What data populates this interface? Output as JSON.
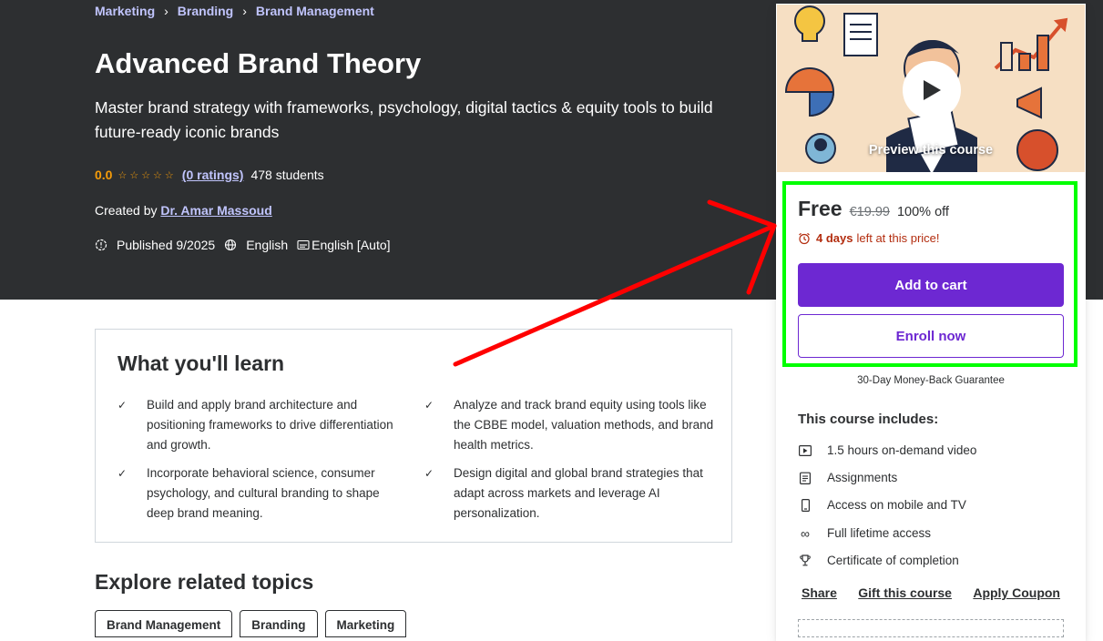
{
  "breadcrumb": [
    "Marketing",
    "Branding",
    "Brand Management"
  ],
  "course": {
    "title": "Advanced Brand Theory",
    "subtitle": "Master brand strategy with frameworks, psychology, digital tactics & equity tools to build future-ready iconic brands",
    "rating": "0.0",
    "stars": "☆☆☆☆☆",
    "ratings_count": "(0 ratings)",
    "students": "478 students",
    "created_by_label": "Created by",
    "instructor": "Dr. Amar Massoud",
    "published": "Published 9/2025",
    "language": "English",
    "captions": "English [Auto]"
  },
  "learn": {
    "title": "What you'll learn",
    "check_icon": "✓",
    "items": [
      "Build and apply brand architecture and positioning frameworks to drive differentiation and growth.",
      "Analyze and track brand equity using tools like the CBBE model, valuation methods, and brand health metrics.",
      "Incorporate behavioral science, consumer psychology, and cultural branding to shape deep brand meaning.",
      "Design digital and global brand strategies that adapt across markets and leverage AI personalization."
    ]
  },
  "explore": {
    "title": "Explore related topics",
    "topics": [
      "Brand Management",
      "Branding",
      "Marketing"
    ]
  },
  "sidebar": {
    "preview_label": "Preview this course",
    "price": "Free",
    "original_price": "€19.99",
    "discount": "100% off",
    "timer_days": "4 days",
    "timer_text": "left at this price!",
    "add_to_cart": "Add to cart",
    "enroll_now": "Enroll now",
    "guarantee": "30-Day Money-Back Guarantee",
    "includes_title": "This course includes:",
    "includes": [
      {
        "icon": "video-icon",
        "text": "1.5 hours on-demand video"
      },
      {
        "icon": "assignment-icon",
        "text": "Assignments"
      },
      {
        "icon": "mobile-icon",
        "text": "Access on mobile and TV"
      },
      {
        "icon": "infinity-icon",
        "text": "Full lifetime access"
      },
      {
        "icon": "trophy-icon",
        "text": "Certificate of completion"
      }
    ],
    "links": [
      "Share",
      "Gift this course",
      "Apply Coupon"
    ]
  },
  "colors": {
    "hero_bg": "#2d2f31",
    "accent": "#6d28d2",
    "link": "#c0c4fc",
    "star": "#f69c08",
    "timer": "#b32d0f",
    "highlight": "#00ff00",
    "annotation_arrow": "#ff0000"
  }
}
